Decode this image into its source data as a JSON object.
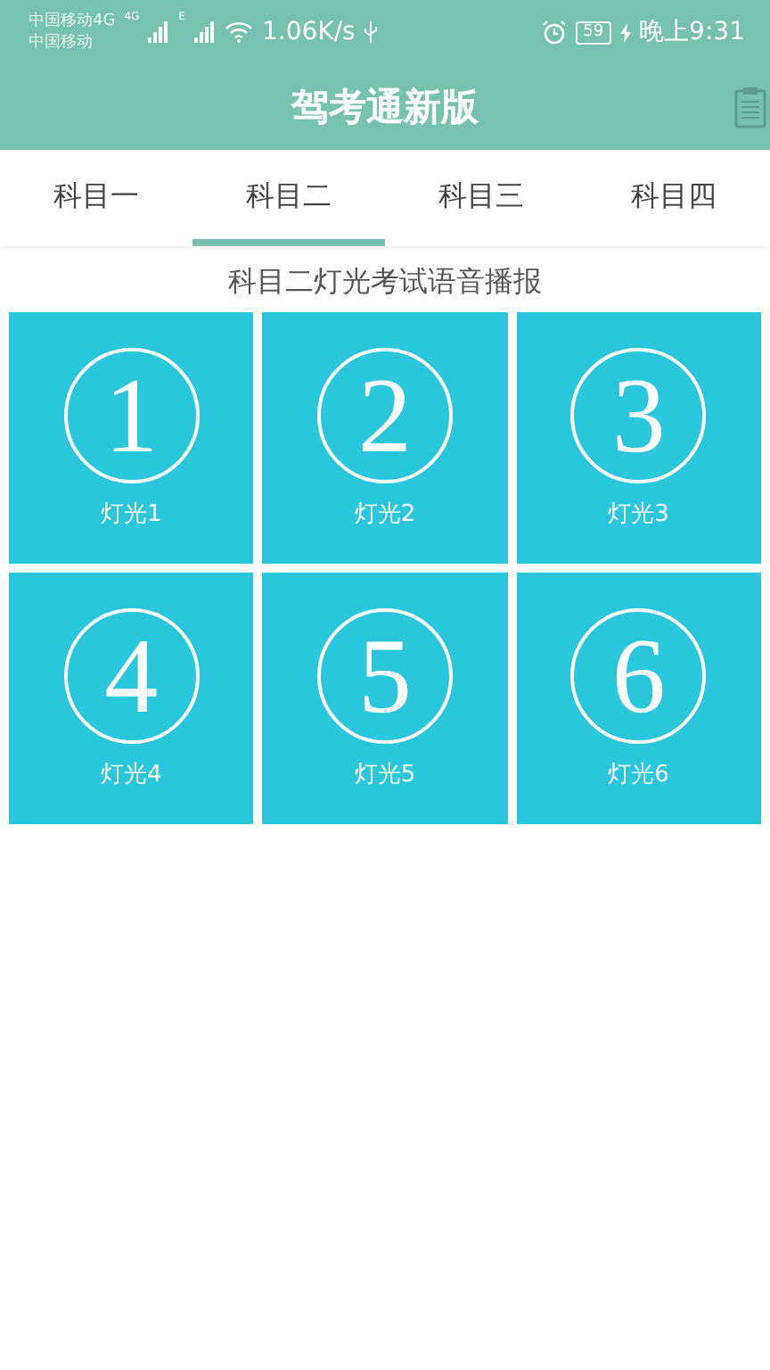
{
  "status_bar": {
    "carrier_1": "中国移动4G",
    "carrier_2": "中国移动",
    "network_1": "4G",
    "network_2": "E",
    "speed": "1.06K/s",
    "battery": "59",
    "time": "晚上9:31"
  },
  "header": {
    "title": "驾考通新版"
  },
  "tabs": [
    {
      "label": "科目一",
      "selected": false
    },
    {
      "label": "科目二",
      "selected": true
    },
    {
      "label": "科目三",
      "selected": false
    },
    {
      "label": "科目四",
      "selected": false
    }
  ],
  "subtitle": "科目二灯光考试语音播报",
  "tiles": [
    {
      "number": "1",
      "label": "灯光1"
    },
    {
      "number": "2",
      "label": "灯光2"
    },
    {
      "number": "3",
      "label": "灯光3"
    },
    {
      "number": "4",
      "label": "灯光4"
    },
    {
      "number": "5",
      "label": "灯光5"
    },
    {
      "number": "6",
      "label": "灯光6"
    }
  ]
}
